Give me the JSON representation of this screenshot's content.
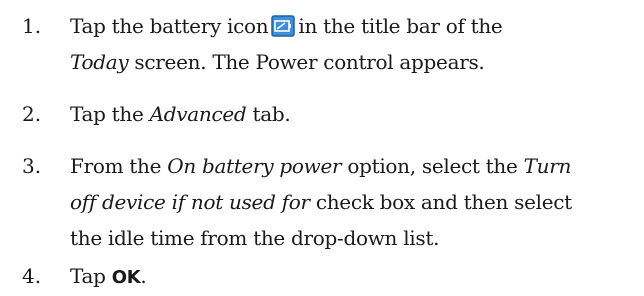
{
  "steps": [
    {
      "number": "1.",
      "line1_before_icon": "Tap the battery icon",
      "icon": "battery-icon",
      "line1_after_icon": "in the title bar of the",
      "line2_italic": "Today",
      "line2_rest": "screen. The Power control appears."
    },
    {
      "number": "2.",
      "before": "Tap the",
      "italic": "Advanced",
      "after": "tab."
    },
    {
      "number": "3.",
      "line1_before": "From the",
      "line1_italic_a": "On battery power",
      "line1_mid": "option, select the",
      "line1_italic_b": "Turn",
      "line2_italic": "off device if not used for",
      "line2_rest": "check box and then select",
      "line3": "the idle time from the drop-down list."
    },
    {
      "number": "4.",
      "before": "Tap",
      "bold": "OK",
      "after": "."
    }
  ],
  "colors": {
    "icon_fill": "#3f8fd6",
    "icon_border": "#1f5fa8",
    "text": "#1a1a1a"
  }
}
